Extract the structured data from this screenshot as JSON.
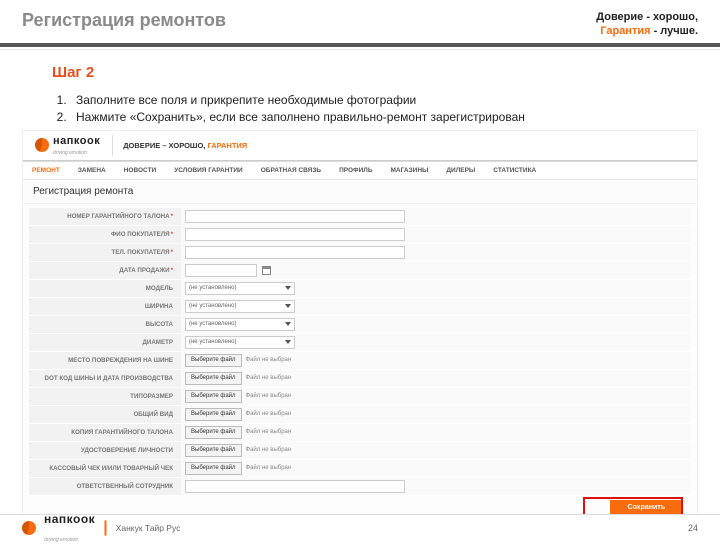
{
  "header": {
    "title": "Регистрация ремонтов",
    "tagline_1": "Доверие - хорошо,",
    "tagline_2a": "Гарантия",
    "tagline_2b": " - лучше."
  },
  "step": {
    "heading": "Шаг 2",
    "instr": [
      "Заполните все  поля и прикрепите необходимые фотографии",
      " Нажмите «Сохранить», если все заполнено правильно-ремонт зарегистрирован"
    ]
  },
  "site": {
    "brand": "напкоок",
    "motto": "driving emotion",
    "slogan_a": "ДОВЕРИЕ – ХОРОШО, ",
    "slogan_b": "ГАРАНТИЯ",
    "nav": [
      "РЕМОНТ",
      "ЗАМЕНА",
      "НОВОСТИ",
      "УСЛОВИЯ ГАРАНТИИ",
      "ОБРАТНАЯ СВЯЗЬ",
      "ПРОФИЛЬ",
      "МАГАЗИНЫ",
      "ДИЛЕРЫ",
      "СТАТИСТИКА"
    ],
    "page_title": "Регистрация ремонта",
    "form": {
      "labels": {
        "ticket": "НОМЕР ГАРАНТИЙНОГО ТАЛОНА",
        "fio": "ФИО ПОКУПАТЕЛЯ",
        "phone": "ТЕЛ. ПОКУПАТЕЛЯ",
        "date": "ДАТА ПРОДАЖИ",
        "model": "МОДЕЛЬ",
        "width": "ШИРИНА",
        "height": "ВЫСОТА",
        "diameter": "ДИАМЕТР",
        "damage": "МЕСТО ПОВРЕЖДЕНИЯ НА ШИНЕ",
        "dot": "DOT КОД ШИНЫ И ДАТА ПРОИЗВОДСТВА",
        "size": "ТИПОРАЗМЕР",
        "view": "ОБЩИЙ ВИД",
        "tickcopy": "КОПИЯ ГАРАНТИЙНОГО ТАЛОНА",
        "id": "УДОСТОВЕРЕНИЕ ЛИЧНОСТИ",
        "receipt": "КАССОВЫЙ ЧЕК И/ИЛИ ТОВАРНЫЙ ЧЕК",
        "emp": "ОТВЕТСТВЕННЫЙ СОТРУДНИК"
      },
      "not_set": "(не установлено)",
      "file_btn": "Выберите файл",
      "file_none": "Файл не выбран",
      "save": "Сохранить"
    }
  },
  "footer": {
    "company": "Ханкук Тайр Рус",
    "page": "24"
  }
}
